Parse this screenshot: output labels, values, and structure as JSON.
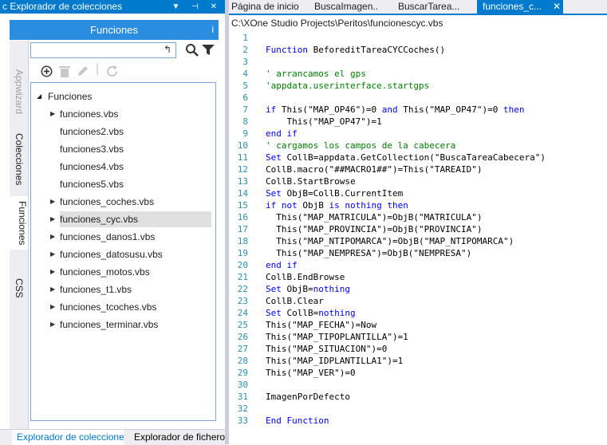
{
  "panel": {
    "title": "c Explorador de colecciones",
    "controls": "▼ ⊣ ✕"
  },
  "side_tabs": [
    "Appwizard",
    "Colecciones",
    "Funciones",
    "CSS"
  ],
  "functions_header": {
    "title": "Funciones",
    "info": "i"
  },
  "search": {
    "value": "",
    "back": "↰"
  },
  "tree": {
    "root": "Funciones",
    "items": [
      {
        "label": "funciones.vbs",
        "expandable": true
      },
      {
        "label": "funciones2.vbs",
        "expandable": false
      },
      {
        "label": "funciones3.vbs",
        "expandable": false
      },
      {
        "label": "funciones4.vbs",
        "expandable": false
      },
      {
        "label": "funciones5.vbs",
        "expandable": false
      },
      {
        "label": "funciones_coches.vbs",
        "expandable": true
      },
      {
        "label": "funciones_cyc.vbs",
        "expandable": true,
        "selected": true
      },
      {
        "label": "funciones_danos1.vbs",
        "expandable": true
      },
      {
        "label": "funciones_datosusu.vbs",
        "expandable": true
      },
      {
        "label": "funciones_motos.vbs",
        "expandable": true
      },
      {
        "label": "funciones_t1.vbs",
        "expandable": true
      },
      {
        "label": "funciones_tcoches.vbs",
        "expandable": true
      },
      {
        "label": "funciones_terminar.vbs",
        "expandable": true
      }
    ]
  },
  "bottom_tabs": [
    "Explorador de coleccione",
    "Explorador de ficheros"
  ],
  "editor_tabs": [
    {
      "label": "Página de inicio",
      "active": false
    },
    {
      "label": "BuscaImagen...",
      "active": false
    },
    {
      "label": "BuscarTarea...",
      "active": false
    },
    {
      "label": "funciones_c...",
      "active": true
    }
  ],
  "file_path": "C:\\XOne Studio Projects\\Peritos\\funcionescyc.vbs",
  "code_lines": [
    "",
    "Function BeforeditTareaCYCCoches()",
    "",
    "' arrancamos el gps",
    "'appdata.userinterface.startgps",
    "",
    "if This(\"MAP_OP46\")=0 and This(\"MAP_OP47\")=0 then",
    "    This(\"MAP_OP47\")=1",
    "end if",
    "' cargamos los campos de la cabecera",
    "Set CollB=appdata.GetCollection(\"BuscaTareaCabecera\")",
    "CollB.macro(\"##MACRO1##\")=This(\"TAREAID\")",
    "CollB.StartBrowse",
    "Set ObjB=CollB.CurrentItem",
    "if not ObjB is nothing then",
    "  This(\"MAP_MATRICULA\")=ObjB(\"MATRICULA\")",
    "  This(\"MAP_PROVINCIA\")=ObjB(\"PROVINCIA\")",
    "  This(\"MAP_NTIPOMARCA\")=ObjB(\"MAP_NTIPOMARCA\")",
    "  This(\"MAP_NEMPRESA\")=ObjB(\"NEMPRESA\")",
    "end if",
    "CollB.EndBrowse",
    "Set ObjB=nothing",
    "CollB.Clear",
    "Set CollB=nothing",
    "This(\"MAP_FECHA\")=Now",
    "This(\"MAP_TIPOPLANTILLA\")=1",
    "This(\"MAP_SITUACION\")=0",
    "This(\"MAP_IDPLANTILLA1\")=1",
    "This(\"MAP_VER\")=0",
    "",
    "ImagenPorDefecto",
    "",
    "End Function"
  ]
}
